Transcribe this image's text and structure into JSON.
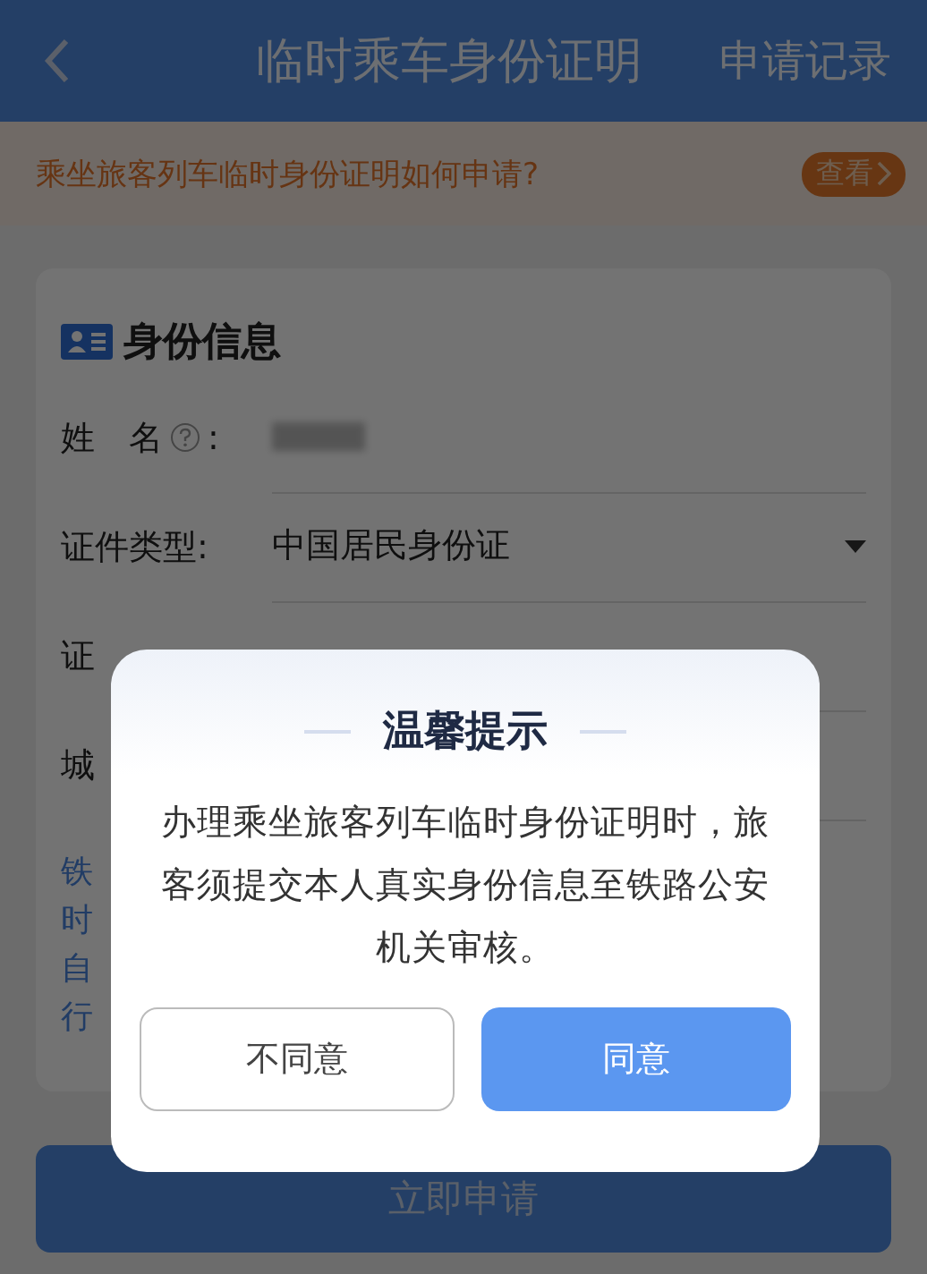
{
  "header": {
    "title": "临时乘车身份证明",
    "action": "申请记录"
  },
  "notice": {
    "text": "乘坐旅客列车临时身份证明如何申请?",
    "button": "查看"
  },
  "card": {
    "title": "身份信息",
    "fields": [
      {
        "kind": "name",
        "label": "姓　名",
        "colon": ":",
        "value_redacted": true
      },
      {
        "kind": "select",
        "label": "证件类型:",
        "value": "中国居民身份证"
      },
      {
        "kind": "partial",
        "label": "证"
      },
      {
        "kind": "partial",
        "label": "城"
      }
    ],
    "note_lines": [
      "铁",
      "时",
      "自",
      "行"
    ]
  },
  "submit": "立即申请",
  "dialog": {
    "title": "温馨提示",
    "message": "办理乘坐旅客列车临时身份证明时，旅客须提交本人真实身份信息至铁路公安机关审核。",
    "buttons": [
      {
        "label": "不同意",
        "primary": false
      },
      {
        "label": "同意",
        "primary": true
      }
    ]
  }
}
